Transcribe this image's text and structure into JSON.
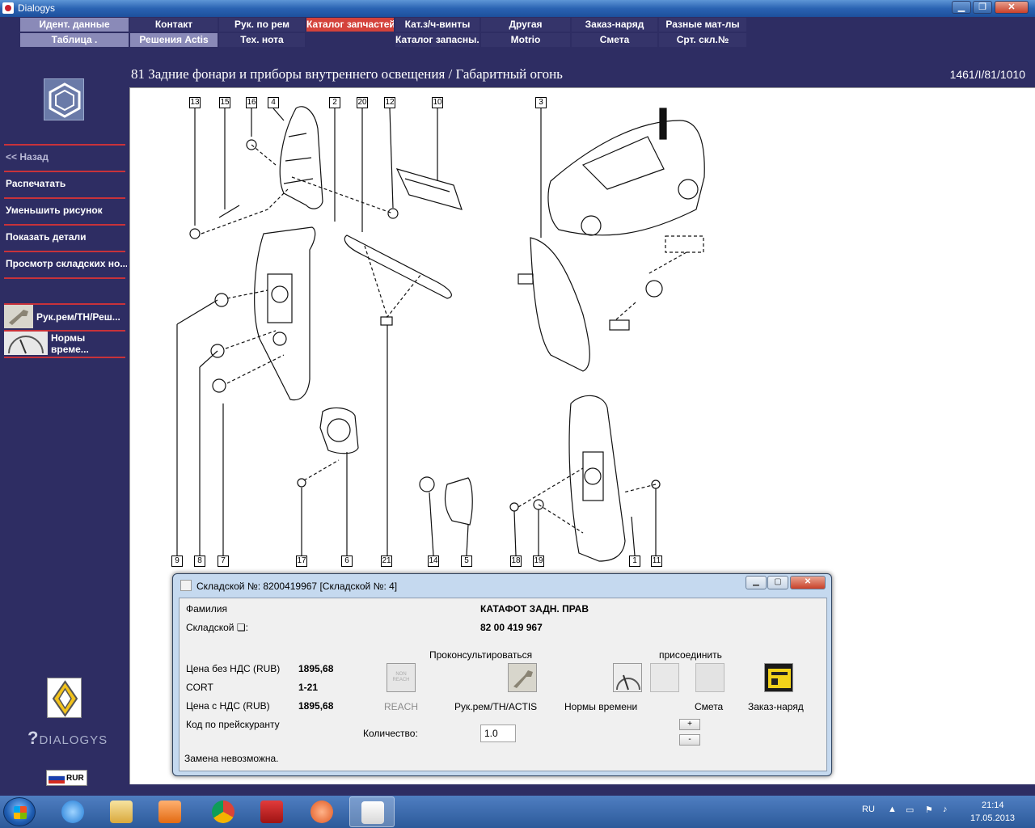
{
  "window": {
    "title": "Dialogys",
    "buttons": {
      "minimize": "▁",
      "maximize": "❐",
      "close": "✕"
    }
  },
  "tabs": {
    "row1": [
      "Идент. данные",
      "Контакт",
      "Рук. по рем",
      "Каталог запчастей",
      "Кат.з/ч-винты",
      "Другая",
      "Заказ-наряд",
      "Разные мат-лы"
    ],
    "row2": [
      "Таблица .",
      "Решения Actis",
      "Тех. нота",
      "",
      "Каталог запасны...",
      "Motrio",
      "Смета",
      "Срт. скл.№"
    ],
    "active": "Каталог запчастей"
  },
  "header": {
    "title": "81 Задние фонари и приборы внутреннего освещения / Габаритный огонь",
    "code": "1461/I/81/1010"
  },
  "sidebar": {
    "links": [
      "<< Назад",
      "Распечатать",
      "Уменьшить рисунок",
      "Показать детали",
      "Просмотр складских но..."
    ],
    "tool_buttons": [
      "Рук.рем/ТН/Реш...",
      "Нормы време..."
    ],
    "brand_text": "DIALOGYS",
    "currency": "RUR"
  },
  "diagram": {
    "callouts_top": [
      "13",
      "15",
      "16",
      "4",
      "2",
      "20",
      "12",
      "10",
      "3"
    ],
    "callouts_bottom": [
      "9",
      "8",
      "7",
      "17",
      "6",
      "21",
      "14",
      "5",
      "18",
      "19",
      "1",
      "11"
    ]
  },
  "dialog": {
    "title": "Складской №: 8200419967 [Складской №: 4]",
    "buttons": {
      "minimize": "▁",
      "maximize": "▢",
      "close": "✕"
    },
    "family_label": "Фамилия",
    "family_value": "КАТАФОТ ЗАДН. ПРАВ",
    "part_label": "Складской ❏:",
    "part_value": "82 00 419 967",
    "price_ex_vat_label": "Цена без НДС (RUB)",
    "price_ex_vat": "1895,68",
    "cort_label": "CORT",
    "cort_value": "1-21",
    "price_vat_label": "Цена с НДС (RUB)",
    "price_vat": "1895,68",
    "pricelist_label": "Код по прейскуранту",
    "consult_label": "Проконсультироваться",
    "attach_label": "присоединить",
    "reach_icon_text": "NON REACH",
    "actions": [
      "REACH",
      "Рук.рем/ТН/ACTIS",
      "Нормы времени",
      "Смета",
      "Заказ-наряд"
    ],
    "quantity_label": "Количество:",
    "quantity_value": "1.0",
    "spin_plus": "+",
    "spin_minus": "-",
    "status": "Замена невозможна."
  },
  "taskbar": {
    "lang": "RU",
    "time": "21:14",
    "date": "17.05.2013"
  },
  "colors": {
    "background": "#2e2d63",
    "tab_light": "#8a8ab8",
    "tab_dark": "#35346a",
    "tab_active": "#d4423b",
    "separator": "#c8323a",
    "dialog_frame": "#c5d9ef"
  }
}
